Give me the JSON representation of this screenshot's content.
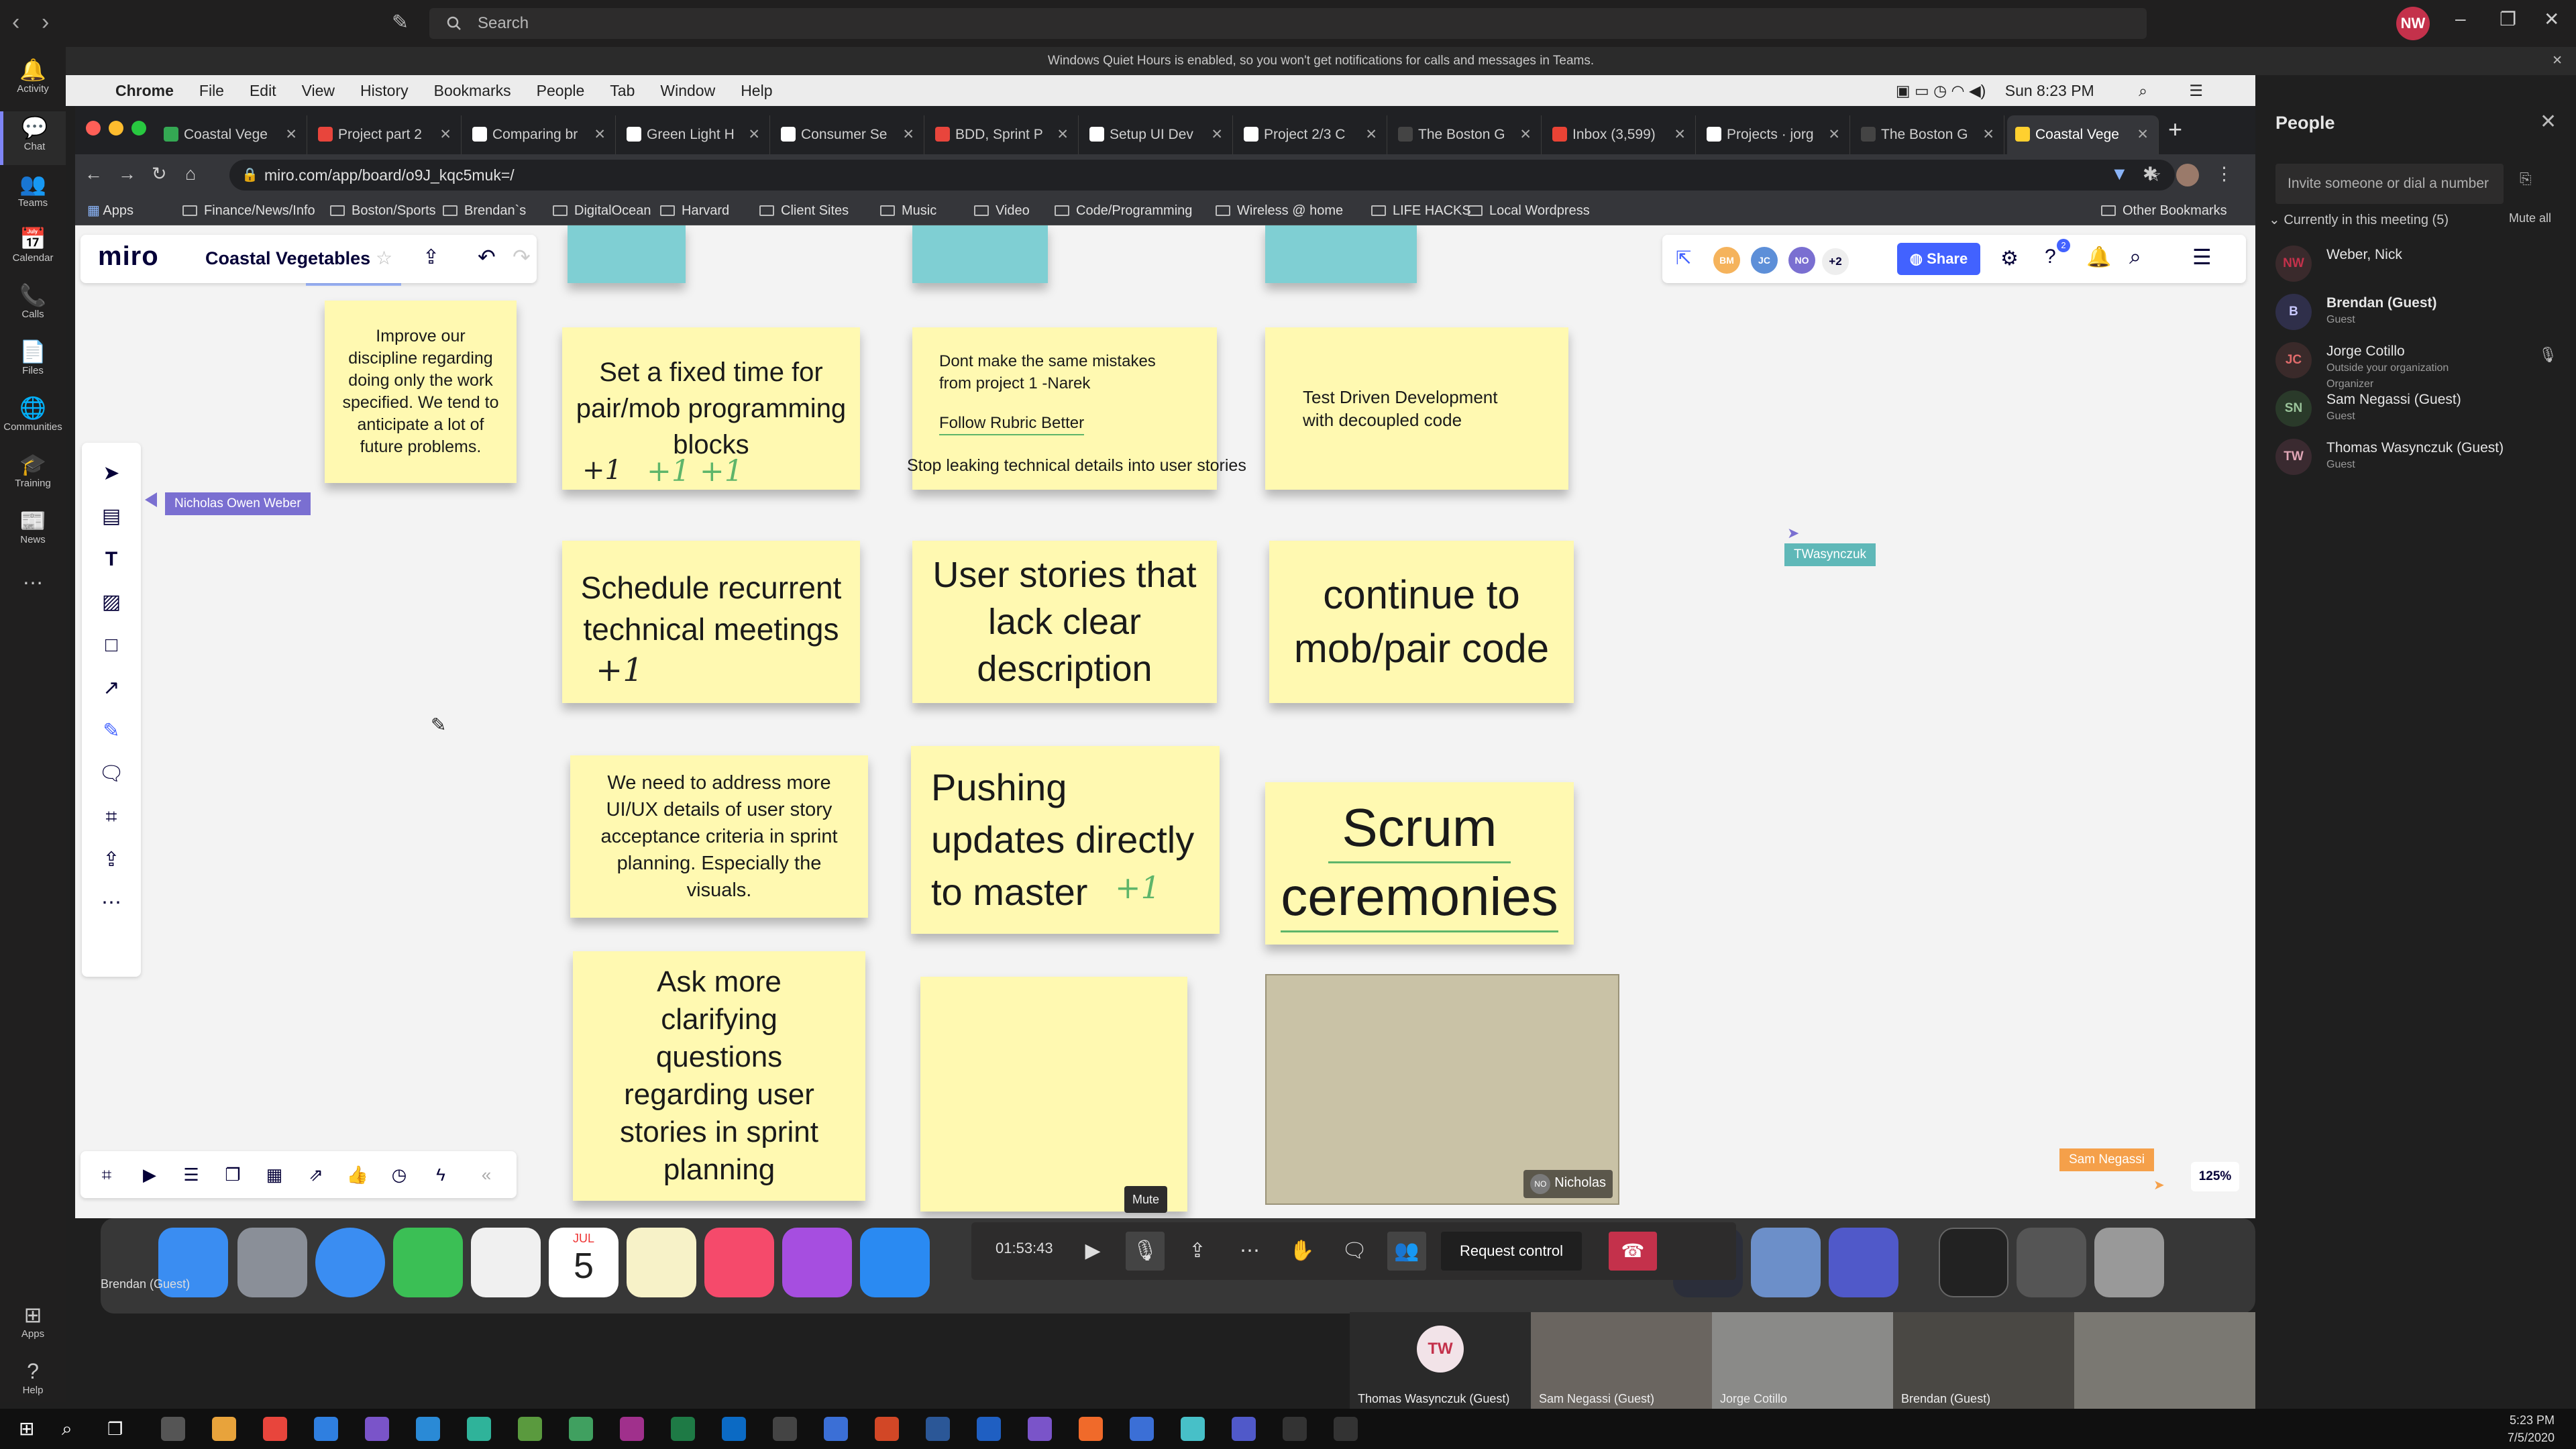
{
  "teams": {
    "search_placeholder": "Search",
    "avatar_initials": "NW",
    "quiet_hours_banner": "Windows Quiet Hours is enabled, so you won't get notifications for calls and messages in Teams.",
    "rail": [
      {
        "label": "Activity",
        "glyph": "🔔"
      },
      {
        "label": "Chat",
        "glyph": "💬"
      },
      {
        "label": "Teams",
        "glyph": "👥"
      },
      {
        "label": "Calendar",
        "glyph": "📅"
      },
      {
        "label": "Calls",
        "glyph": "📞"
      },
      {
        "label": "Files",
        "glyph": "📄"
      },
      {
        "label": "Communities",
        "glyph": "🌐"
      },
      {
        "label": "Training",
        "glyph": "🎓"
      },
      {
        "label": "News",
        "glyph": "📰"
      },
      {
        "label": "",
        "glyph": "…"
      },
      {
        "label": "Apps",
        "glyph": "⊞"
      },
      {
        "label": "Help",
        "glyph": "?"
      }
    ],
    "people": {
      "title": "People",
      "invite_placeholder": "Invite someone or dial a number",
      "in_meeting": "Currently in this meeting (5)",
      "mute_all": "Mute all",
      "participants": [
        {
          "initials": "NW",
          "name": "Weber, Nick",
          "sub1": "",
          "sub2": "",
          "color": "#c4314b",
          "bg": "#3a2a2c"
        },
        {
          "initials": "B",
          "name": "Brendan (Guest)",
          "sub1": "Guest",
          "sub2": "",
          "color": "#c8c8ff",
          "bg": "#2f2f4a"
        },
        {
          "initials": "JC",
          "name": "Jorge Cotillo",
          "sub1": "Outside your organization",
          "sub2": "Organizer",
          "color": "#e06b6b",
          "bg": "#3a2a2a"
        },
        {
          "initials": "SN",
          "name": "Sam Negassi (Guest)",
          "sub1": "Guest",
          "sub2": "",
          "color": "#9bc49b",
          "bg": "#2a3a2a"
        },
        {
          "initials": "TW",
          "name": "Thomas Wasynczuk (Guest)",
          "sub1": "Guest",
          "sub2": "",
          "color": "#e0a6b6",
          "bg": "#3a2a30"
        }
      ]
    },
    "call": {
      "timer": "01:53:43",
      "mute_tooltip": "Mute",
      "request_control": "Request control"
    },
    "videos": [
      {
        "name": "Thomas Wasynczuk (Guest)",
        "initials": "TW"
      },
      {
        "name": "Sam Negassi (Guest)"
      },
      {
        "name": "Jorge Cotillo"
      },
      {
        "name": "Brendan (Guest)"
      },
      {
        "name": ""
      }
    ],
    "self_label": "Brendan (Guest)"
  },
  "mac": {
    "menu": [
      "Chrome",
      "File",
      "Edit",
      "View",
      "History",
      "Bookmarks",
      "People",
      "Tab",
      "Window",
      "Help"
    ],
    "clock": "Sun 8:23 PM",
    "dock_calendar_month": "JUL",
    "dock_calendar_day": "5"
  },
  "chrome": {
    "tabs": [
      {
        "title": "Coastal Vege",
        "fav": "#34a853"
      },
      {
        "title": "Project part 2",
        "fav": "#e8453c"
      },
      {
        "title": "Comparing br",
        "fav": "#ffffff"
      },
      {
        "title": "Green Light H",
        "fav": "#ffffff"
      },
      {
        "title": "Consumer Se",
        "fav": "#ffffff"
      },
      {
        "title": "BDD, Sprint P",
        "fav": "#e8453c"
      },
      {
        "title": "Setup UI Dev",
        "fav": "#ffffff"
      },
      {
        "title": "Project 2/3 C",
        "fav": "#ffffff"
      },
      {
        "title": "The Boston G",
        "fav": "#444444"
      },
      {
        "title": "Inbox (3,599)",
        "fav": "#ea4335"
      },
      {
        "title": "Projects · jorg",
        "fav": "#ffffff"
      },
      {
        "title": "The Boston G",
        "fav": "#444444"
      },
      {
        "title": "Coastal Vege",
        "fav": "#ffd02f"
      }
    ],
    "url": "miro.com/app/board/o9J_kqc5muk=/",
    "bookmarks": [
      "Apps",
      "Finance/News/Info",
      "Boston/Sports",
      "Brendan`s",
      "DigitalOcean",
      "Harvard",
      "Client Sites",
      "Music",
      "Video",
      "Code/Programming",
      "Wireless @ home",
      "LIFE HACKS",
      "Local Wordpress"
    ],
    "other_bookmarks": "Other Bookmarks"
  },
  "miro": {
    "logo": "miro",
    "board_name": "Coastal Vegetables",
    "share": "Share",
    "more_collaborators": "+2",
    "notif_count": "2",
    "zoom": "125%",
    "collaborators": [
      {
        "initials": "BM",
        "color": "#f5b35c"
      },
      {
        "initials": "JC",
        "color": "#5d8fd8"
      },
      {
        "initials": "NO",
        "color": "#7a6fd1"
      }
    ],
    "cursors": {
      "nicholas": "Nicholas Owen Weber",
      "twasynczuk": "TWasynczuk",
      "sam": "Sam Negassi",
      "nicholas_video": "Nicholas",
      "nicholas_video_initials": "NO"
    },
    "stickies": {
      "s1": "Improve our discipline regarding doing only the work specified. We tend to anticipate a lot of future problems.",
      "s2": "Set a fixed time for pair/mob programming blocks",
      "s2_votes_black": "+1",
      "s2_votes_green": "+1  +1",
      "s3_line1": "Dont make the same mistakes from project 1 -Narek",
      "s3_line2": "Follow Rubric Better",
      "s3_line3": "Stop leaking technical details into user stories",
      "s4": "Test Driven Development with decoupled code",
      "s5": "Schedule recurrent technical meetings",
      "s5_vote": "+1",
      "s6": "User stories that lack clear description",
      "s7": "continue to mob/pair code",
      "s8": "We need to address more UI/UX details of user story acceptance criteria in sprint planning. Especially the visuals.",
      "s9": "Pushing updates directly to master",
      "s9_vote": "+1",
      "s10_line1": "Scrum",
      "s10_line2": "ceremonies",
      "s11": "Ask more clarifying questions regarding user stories in sprint planning"
    }
  },
  "windows": {
    "time": "5:23 PM",
    "date": "7/5/2020"
  }
}
